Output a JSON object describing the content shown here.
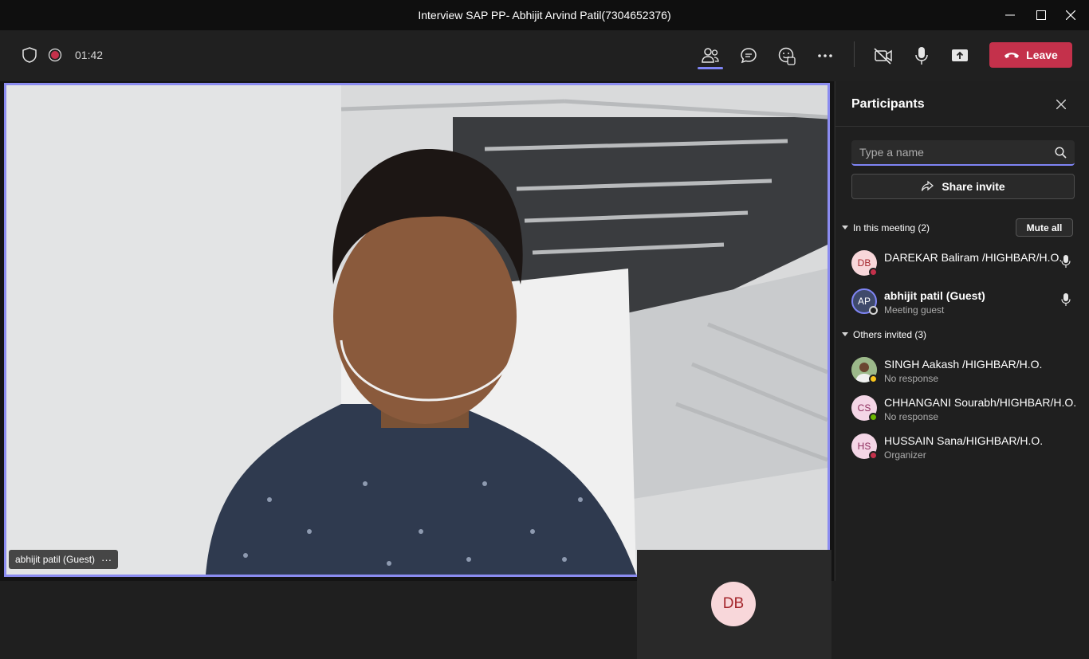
{
  "window": {
    "title": "Interview SAP PP- Abhijit Arvind Patil(7304652376)"
  },
  "toolbar": {
    "timer": "01:42",
    "leave_label": "Leave",
    "icons": [
      "shield-icon",
      "recording-icon",
      "people-icon",
      "chat-icon",
      "reactions-icon",
      "more-icon",
      "camera-off-icon",
      "microphone-icon",
      "share-screen-icon",
      "hang-up-icon"
    ]
  },
  "stage": {
    "main_video_name": "abhijit patil (Guest)",
    "main_video_more": "···",
    "secondary_tile_initials": "DB"
  },
  "participants": {
    "title": "Participants",
    "search_placeholder": "Type a name",
    "share_invite_label": "Share invite",
    "in_meeting_label": "In this meeting (2)",
    "mute_all_label": "Mute all",
    "others_label": "Others invited (3)",
    "in_meeting": [
      {
        "initials": "DB",
        "name": "DAREKAR Baliram /HIGHBAR/H.O.",
        "status_color": "#c4314b"
      },
      {
        "initials": "AP",
        "name": "abhijit patil (Guest)",
        "subtitle": "Meeting guest",
        "status_color": "#8a8a8a"
      }
    ],
    "invited": [
      {
        "initials": "",
        "name": "SINGH Aakash /HIGHBAR/H.O.",
        "subtitle": "No response",
        "status_color": "#f8c41b"
      },
      {
        "initials": "CS",
        "name": "CHHANGANI Sourabh/HIGHBAR/H.O.",
        "subtitle": "No response",
        "status_color": "#6bb700"
      },
      {
        "initials": "HS",
        "name": "HUSSAIN Sana/HIGHBAR/H.O.",
        "subtitle": "Organizer",
        "status_color": "#c4314b"
      }
    ]
  },
  "colors": {
    "accent": "#7f85f5",
    "leave": "#c4314b",
    "background": "#1f1f1f"
  }
}
